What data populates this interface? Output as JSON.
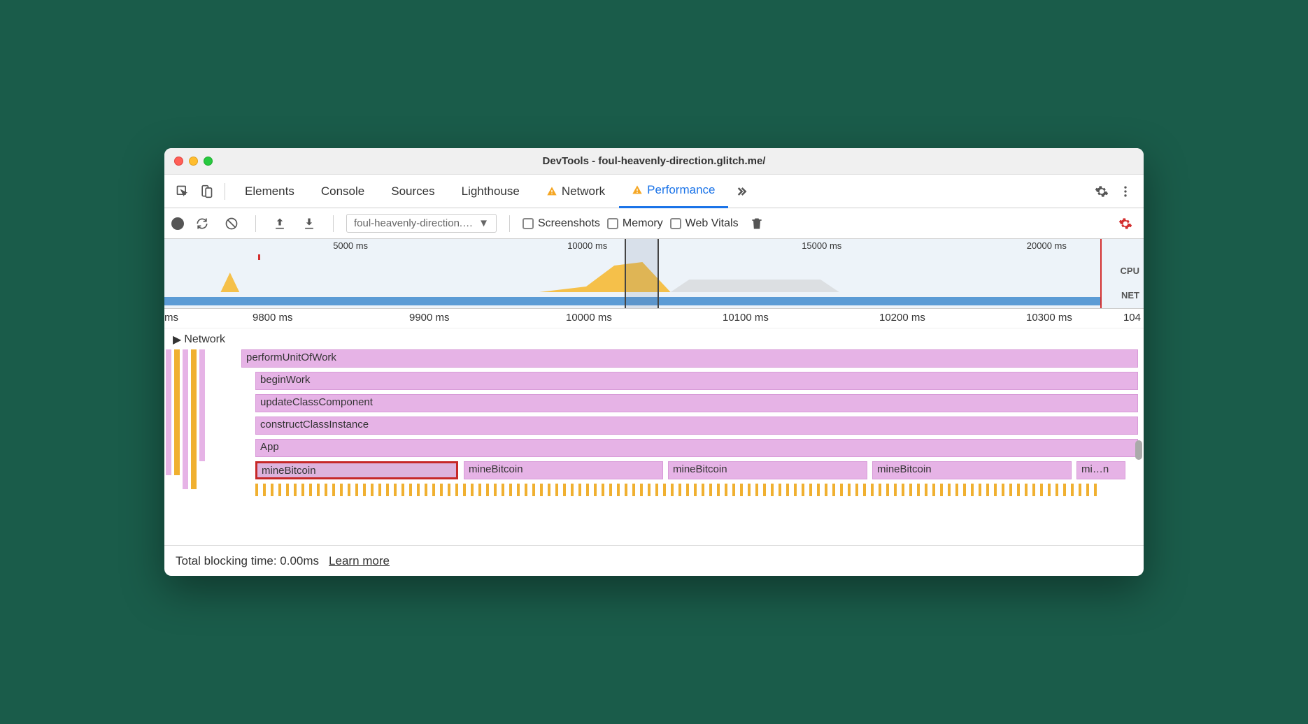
{
  "window": {
    "title": "DevTools - foul-heavenly-direction.glitch.me/"
  },
  "tabs": {
    "elements": "Elements",
    "console": "Console",
    "sources": "Sources",
    "lighthouse": "Lighthouse",
    "network": "Network",
    "performance": "Performance"
  },
  "toolbar": {
    "dropdown": "foul-heavenly-direction.…",
    "screenshots": "Screenshots",
    "memory": "Memory",
    "webvitals": "Web Vitals"
  },
  "overview": {
    "ticks": [
      "5000 ms",
      "10000 ms",
      "15000 ms",
      "20000 ms"
    ],
    "cpu_label": "CPU",
    "net_label": "NET"
  },
  "ruler": {
    "ticks": [
      "ms",
      "9800 ms",
      "9900 ms",
      "10000 ms",
      "10100 ms",
      "10200 ms",
      "10300 ms",
      "104"
    ]
  },
  "tracks": {
    "network": "Network",
    "bars": {
      "performUnitOfWork": "performUnitOfWork",
      "beginWork": "beginWork",
      "updateClassComponent": "updateClassComponent",
      "constructClassInstance": "constructClassInstance",
      "app": "App",
      "mineBitcoin1": "mineBitcoin",
      "mineBitcoin2": "mineBitcoin",
      "mineBitcoin3": "mineBitcoin",
      "mineBitcoin4": "mineBitcoin",
      "mineBitcoin5": "mi…n"
    }
  },
  "footer": {
    "tbt": "Total blocking time: 0.00ms",
    "learn": "Learn more"
  }
}
